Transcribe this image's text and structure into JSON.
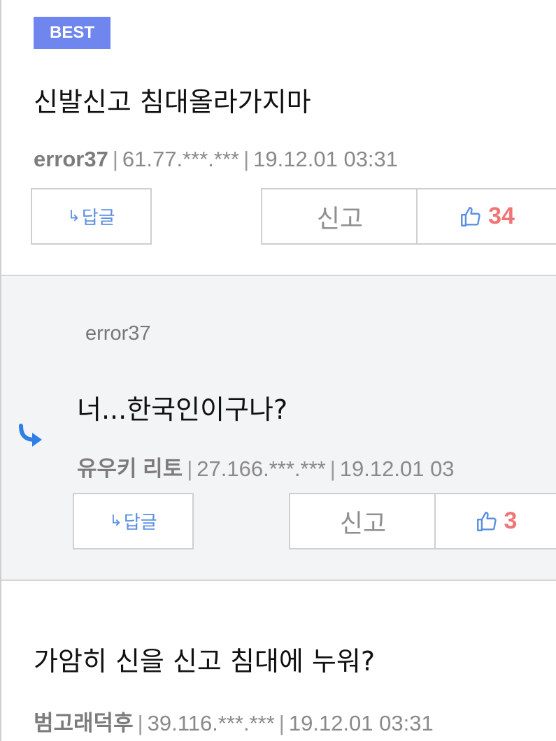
{
  "comments": [
    {
      "badge": "BEST",
      "text": "신발신고 침대올라가지마",
      "nickname": "error37",
      "ip": "61.77.***.***",
      "date": "19.12.01 03:31",
      "reply_label": "답글",
      "report_label": "신고",
      "likes": "34"
    },
    {
      "parent_nickname": "error37",
      "text": "너...한국인이구나?",
      "nickname": "유우키 리토",
      "ip": "27.166.***.***",
      "date": "19.12.01 03",
      "reply_label": "답글",
      "report_label": "신고",
      "likes": "3"
    },
    {
      "text": "가암히 신을 신고 침대에 누워?",
      "nickname": "범고래덕후",
      "ip": "39.116.***.***",
      "date": "19.12.01 03:31"
    }
  ],
  "separator": "|",
  "reply_arrow": "↳",
  "colors": {
    "accent": "#6e86ee",
    "like": "#f07474",
    "reply": "#5a8fe0",
    "reply_indicator": "#2f7fe6"
  },
  "icons": [
    "thumbs-up-icon",
    "reply-arrow-icon"
  ]
}
